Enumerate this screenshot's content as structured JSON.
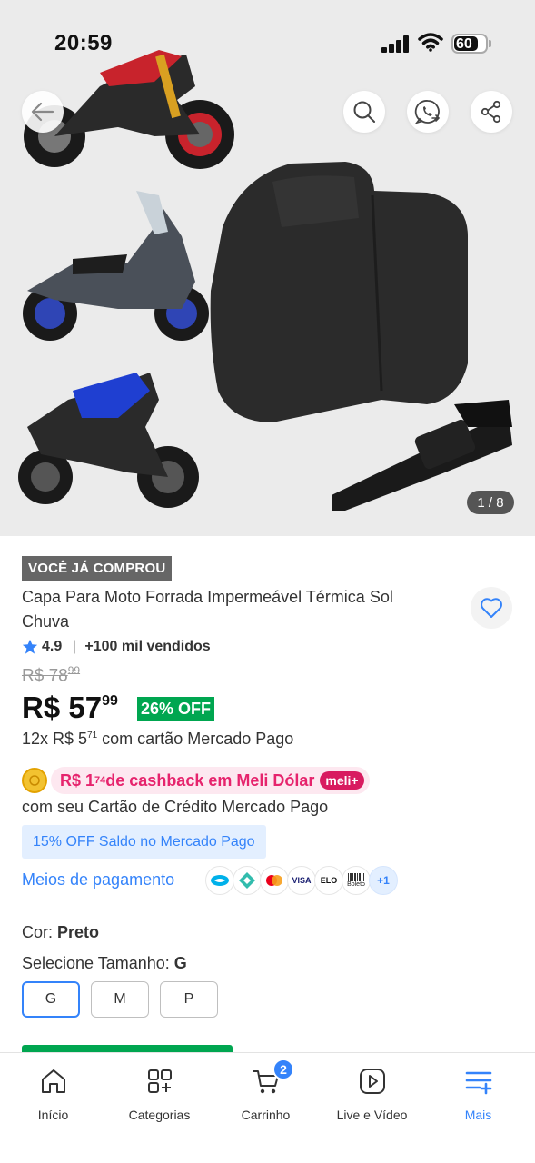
{
  "status_bar": {
    "time": "20:59",
    "battery": "60"
  },
  "gallery": {
    "counter": "1 / 8"
  },
  "product": {
    "bought_tag": "VOCÊ JÁ COMPROU",
    "title": "Capa Para Moto Forrada Impermeável Térmica Sol Chuva",
    "rating": "4.9",
    "sold": "+100 mil vendidos",
    "old_price_int": "R$ 78",
    "old_price_cents": "99",
    "price_int": "R$ 57",
    "price_cents": "99",
    "discount": "26% OFF",
    "installments_prefix": "12x R$ 5",
    "installments_cents": "71",
    "installments_suffix": " com cartão Mercado Pago"
  },
  "cashback": {
    "prefix": "R$ 1",
    "cents": "74",
    "suffix": " de cashback em Meli Dólar",
    "badge": "meli+",
    "card_text": "com seu Cartão de Crédito Mercado Pago"
  },
  "saldo_promo": "15% OFF Saldo no Mercado Pago",
  "payment": {
    "link": "Meios de pagamento",
    "methods": [
      "mercado-pago-icon",
      "pix-icon",
      "mastercard-icon",
      "visa-icon",
      "elo-icon",
      "boleto-icon"
    ],
    "visa_label": "VISA",
    "elo_label": "ELO",
    "boleto_label": "Boleto",
    "more": "+1"
  },
  "variations": {
    "color_label": "Cor: ",
    "color_value": "Preto",
    "size_label": "Selecione Tamanho: ",
    "size_value": "G",
    "sizes": [
      "G",
      "M",
      "P"
    ],
    "selected_size": "G"
  },
  "nav": {
    "items": [
      {
        "label": "Início",
        "icon": "home-icon"
      },
      {
        "label": "Categorias",
        "icon": "categories-icon"
      },
      {
        "label": "Carrinho",
        "icon": "cart-icon"
      },
      {
        "label": "Live e Vídeo",
        "icon": "play-icon"
      },
      {
        "label": "Mais",
        "icon": "menu-plus-icon"
      }
    ],
    "cart_count": "2",
    "active": "Mais"
  },
  "colors": {
    "accent": "#3483fa",
    "green": "#00a650",
    "pink": "#e6246d"
  }
}
